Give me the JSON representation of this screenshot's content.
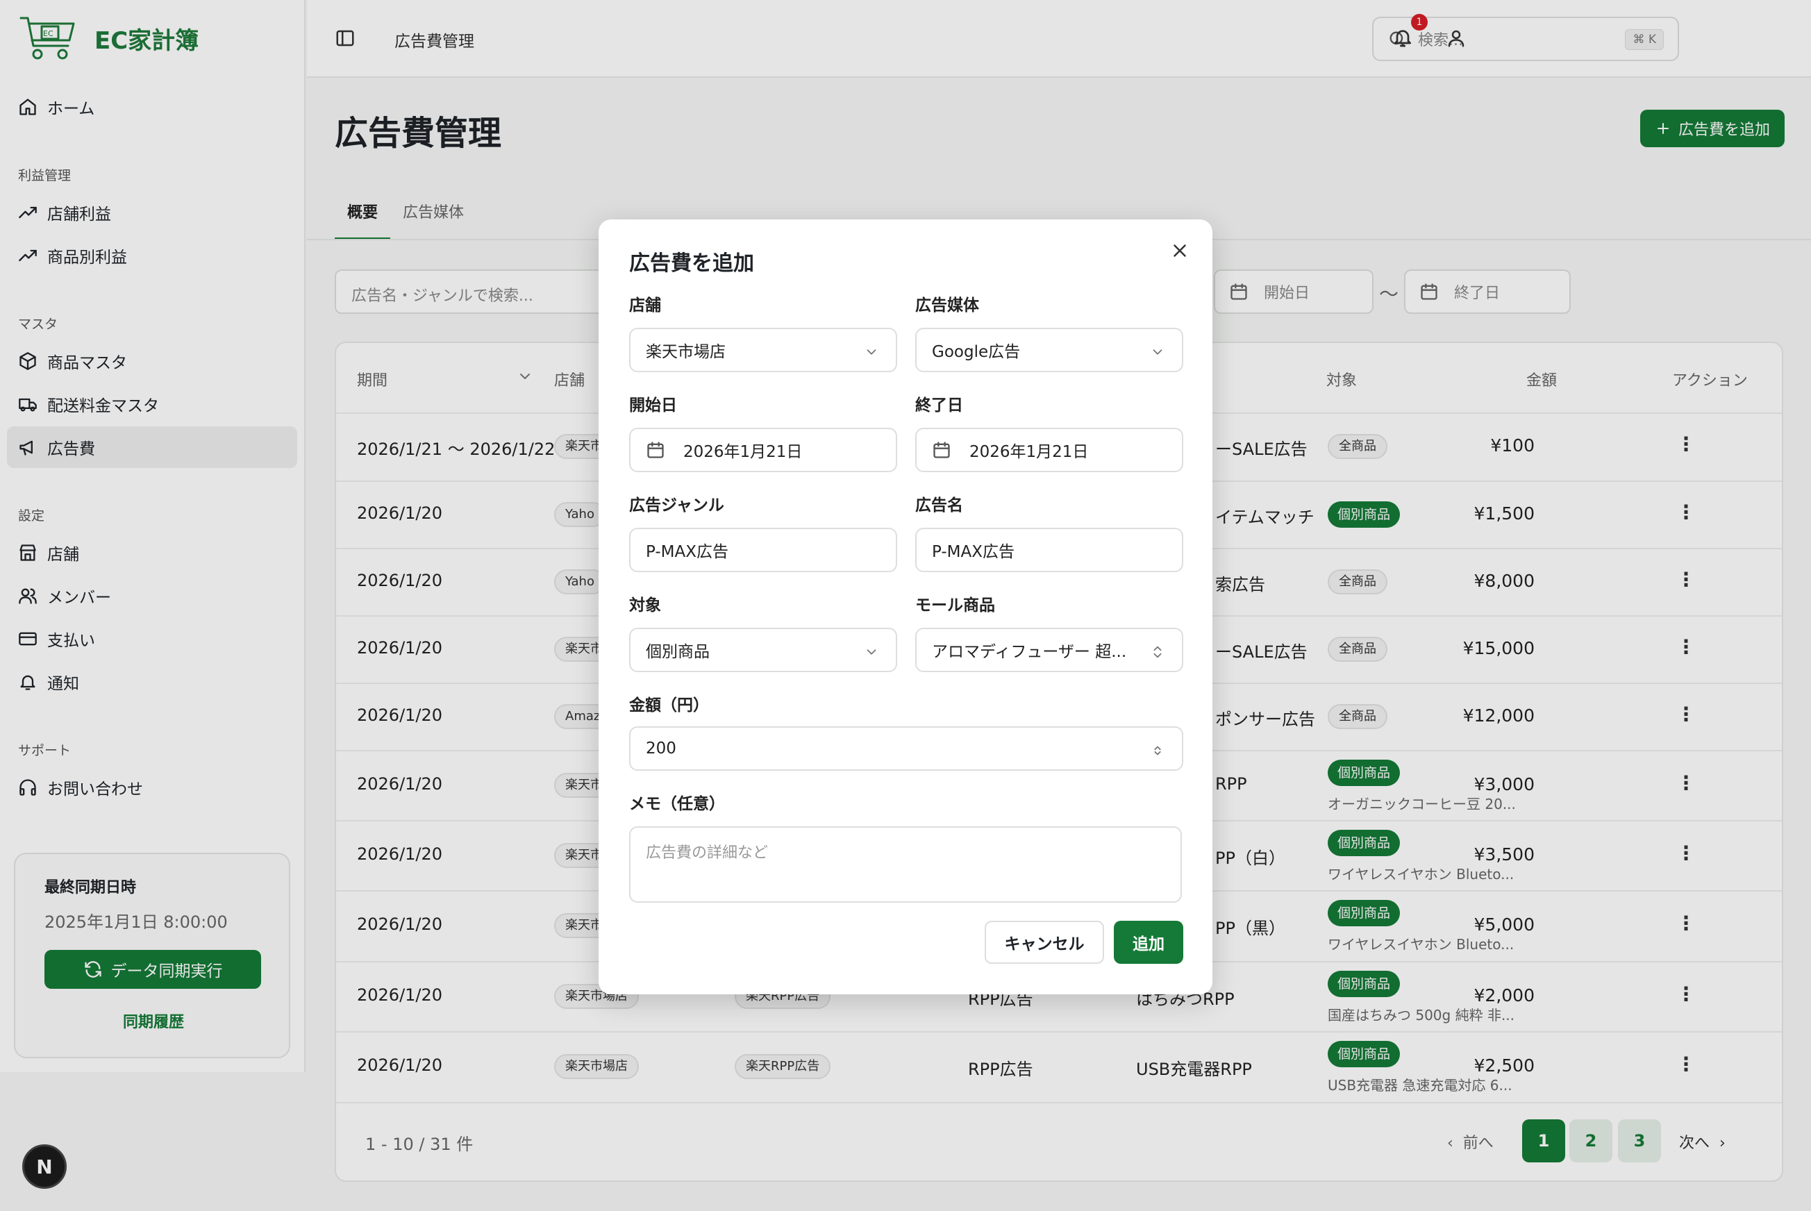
{
  "brand": {
    "name": "EC家計簿",
    "logo_text": "EC"
  },
  "sidebar": {
    "home": "ホーム",
    "section_profit": "利益管理",
    "store_profit": "店舗利益",
    "product_profit": "商品別利益",
    "section_master": "マスタ",
    "product_master": "商品マスタ",
    "shipping_master": "配送料金マスタ",
    "ad_cost": "広告費",
    "section_settings": "設定",
    "store": "店舗",
    "members": "メンバー",
    "payment": "支払い",
    "notifications": "通知",
    "section_support": "サポート",
    "contact": "お問い合わせ",
    "sync": {
      "title": "最終同期日時",
      "time": "2025年1月1日 8:00:00",
      "button": "データ同期実行",
      "history": "同期履歴"
    },
    "avatar_initial": "N"
  },
  "header": {
    "breadcrumb": "広告費管理",
    "search_placeholder": "検索...",
    "shortcut": "⌘ K",
    "notification_count": "1"
  },
  "page": {
    "title": "広告費管理",
    "add_button": "広告費を追加",
    "tabs": [
      "概要",
      "広告媒体"
    ],
    "filter_placeholder": "広告名・ジャンルで検索...",
    "start_date_placeholder": "開始日",
    "end_date_placeholder": "終了日",
    "tilde": "〜"
  },
  "table": {
    "columns": {
      "period": "期間",
      "store": "店舗",
      "target": "対象",
      "amount": "金額",
      "action": "アクション"
    },
    "rows": [
      {
        "period": "2026/1/21 〜 2026/1/22",
        "store": "楽天市",
        "name": "ーSALE広告",
        "target": "全商品",
        "target_kind": "all",
        "product": "",
        "amount": "¥100"
      },
      {
        "period": "2026/1/20",
        "store": "Yaho",
        "name": "イテムマッチ",
        "target": "個別商品",
        "target_kind": "item",
        "product": "",
        "amount": "¥1,500"
      },
      {
        "period": "2026/1/20",
        "store": "Yaho",
        "name": "索広告",
        "target": "全商品",
        "target_kind": "all",
        "product": "",
        "amount": "¥8,000"
      },
      {
        "period": "2026/1/20",
        "store": "楽天市",
        "name": "ーSALE広告",
        "target": "全商品",
        "target_kind": "all",
        "product": "",
        "amount": "¥15,000"
      },
      {
        "period": "2026/1/20",
        "store": "Amaz",
        "name": "ポンサー広告",
        "target": "全商品",
        "target_kind": "all",
        "product": "",
        "amount": "¥12,000"
      },
      {
        "period": "2026/1/20",
        "store": "楽天市",
        "name": "RPP",
        "target": "個別商品",
        "target_kind": "item",
        "product": "オーガニックコーヒー豆 20...",
        "amount": "¥3,000"
      },
      {
        "period": "2026/1/20",
        "store": "楽天市",
        "name": "PP（白）",
        "target": "個別商品",
        "target_kind": "item",
        "product": "ワイヤレスイヤホン Blueto...",
        "amount": "¥3,500"
      },
      {
        "period": "2026/1/20",
        "store": "楽天市",
        "name": "PP（黒）",
        "target": "個別商品",
        "target_kind": "item",
        "product": "ワイヤレスイヤホン Blueto...",
        "amount": "¥5,000"
      },
      {
        "period": "2026/1/20",
        "store": "楽天市場店",
        "medium": "楽天RPP広告",
        "genre": "RPP広告",
        "name": "はちみつRPP",
        "target": "個別商品",
        "target_kind": "item",
        "product": "国産はちみつ 500g 純粋 非...",
        "amount": "¥2,000"
      },
      {
        "period": "2026/1/20",
        "store": "楽天市場店",
        "medium": "楽天RPP広告",
        "genre": "RPP広告",
        "name": "USB充電器RPP",
        "target": "個別商品",
        "target_kind": "item",
        "product": "USB充電器 急速充電対応 6...",
        "amount": "¥2,500"
      }
    ],
    "pagination": {
      "info": "1 - 10 / 31 件",
      "prev": "前へ",
      "next": "次へ",
      "pages": [
        "1",
        "2",
        "3"
      ]
    }
  },
  "modal": {
    "title": "広告費を追加",
    "store_label": "店舗",
    "store_value": "楽天市場店",
    "medium_label": "広告媒体",
    "medium_value": "Google広告",
    "start_label": "開始日",
    "start_value": "2026年1月21日",
    "end_label": "終了日",
    "end_value": "2026年1月21日",
    "genre_label": "広告ジャンル",
    "genre_value": "P-MAX広告",
    "name_label": "広告名",
    "name_value": "P-MAX広告",
    "target_label": "対象",
    "target_value": "個別商品",
    "product_label": "モール商品",
    "product_value": "アロマディフューザー 超...",
    "amount_label": "金額（円）",
    "amount_value": "200",
    "memo_label": "メモ（任意）",
    "memo_placeholder": "広告費の詳細など",
    "cancel": "キャンセル",
    "submit": "追加"
  },
  "colors": {
    "accent": "#157a37",
    "badge": "#d61f26"
  }
}
